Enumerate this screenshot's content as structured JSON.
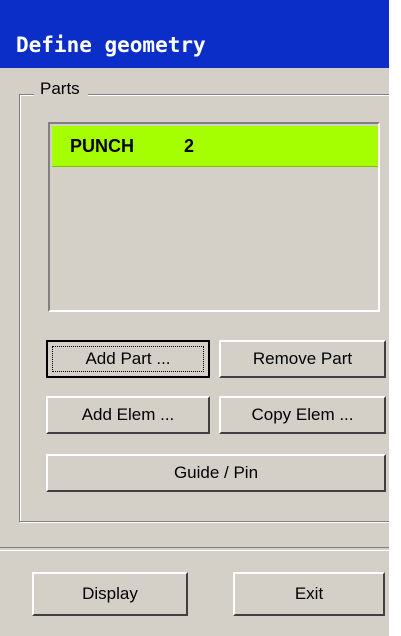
{
  "window": {
    "title": "Define geometry"
  },
  "parts_group": {
    "legend": "Parts",
    "list": [
      {
        "name": "PUNCH",
        "index": "2",
        "selected": true,
        "highlight_color": "#a6ff00"
      }
    ]
  },
  "buttons": {
    "add_part": "Add Part ...",
    "remove_part": "Remove Part",
    "add_elem": "Add Elem ...",
    "copy_elem": "Copy Elem ...",
    "guide_pin": "Guide / Pin",
    "display": "Display",
    "exit": "Exit"
  },
  "colors": {
    "titlebar": "#0b2ec8",
    "face": "#d4d0c8",
    "selection": "#a6ff00"
  }
}
